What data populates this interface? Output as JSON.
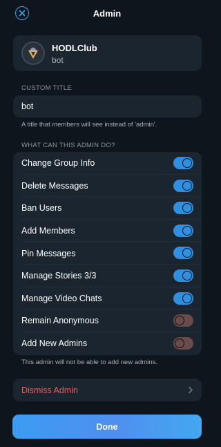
{
  "header": {
    "title": "Admin"
  },
  "profile": {
    "name": "HODLClub",
    "subtitle": "bot"
  },
  "custom_title": {
    "section_label": "CUSTOM TITLE",
    "value": "bot",
    "hint": "A title that members will see instead of 'admin'."
  },
  "permissions": {
    "section_label": "WHAT CAN THIS ADMIN DO?",
    "items": [
      {
        "label": "Change Group Info",
        "enabled": true
      },
      {
        "label": "Delete Messages",
        "enabled": true
      },
      {
        "label": "Ban Users",
        "enabled": true
      },
      {
        "label": "Add Members",
        "enabled": true
      },
      {
        "label": "Pin Messages",
        "enabled": true
      },
      {
        "label": "Manage Stories 3/3",
        "enabled": true
      },
      {
        "label": "Manage Video Chats",
        "enabled": true
      },
      {
        "label": "Remain Anonymous",
        "enabled": false
      },
      {
        "label": "Add New Admins",
        "enabled": false
      }
    ],
    "footer_hint": "This admin will not be able to add new admins."
  },
  "dismiss": {
    "label": "Dismiss Admin"
  },
  "done_button": {
    "label": "Done"
  },
  "colors": {
    "accent": "#3aa2ef",
    "destructive": "#e0625a",
    "background": "#0e151c",
    "card": "#1b2530"
  }
}
